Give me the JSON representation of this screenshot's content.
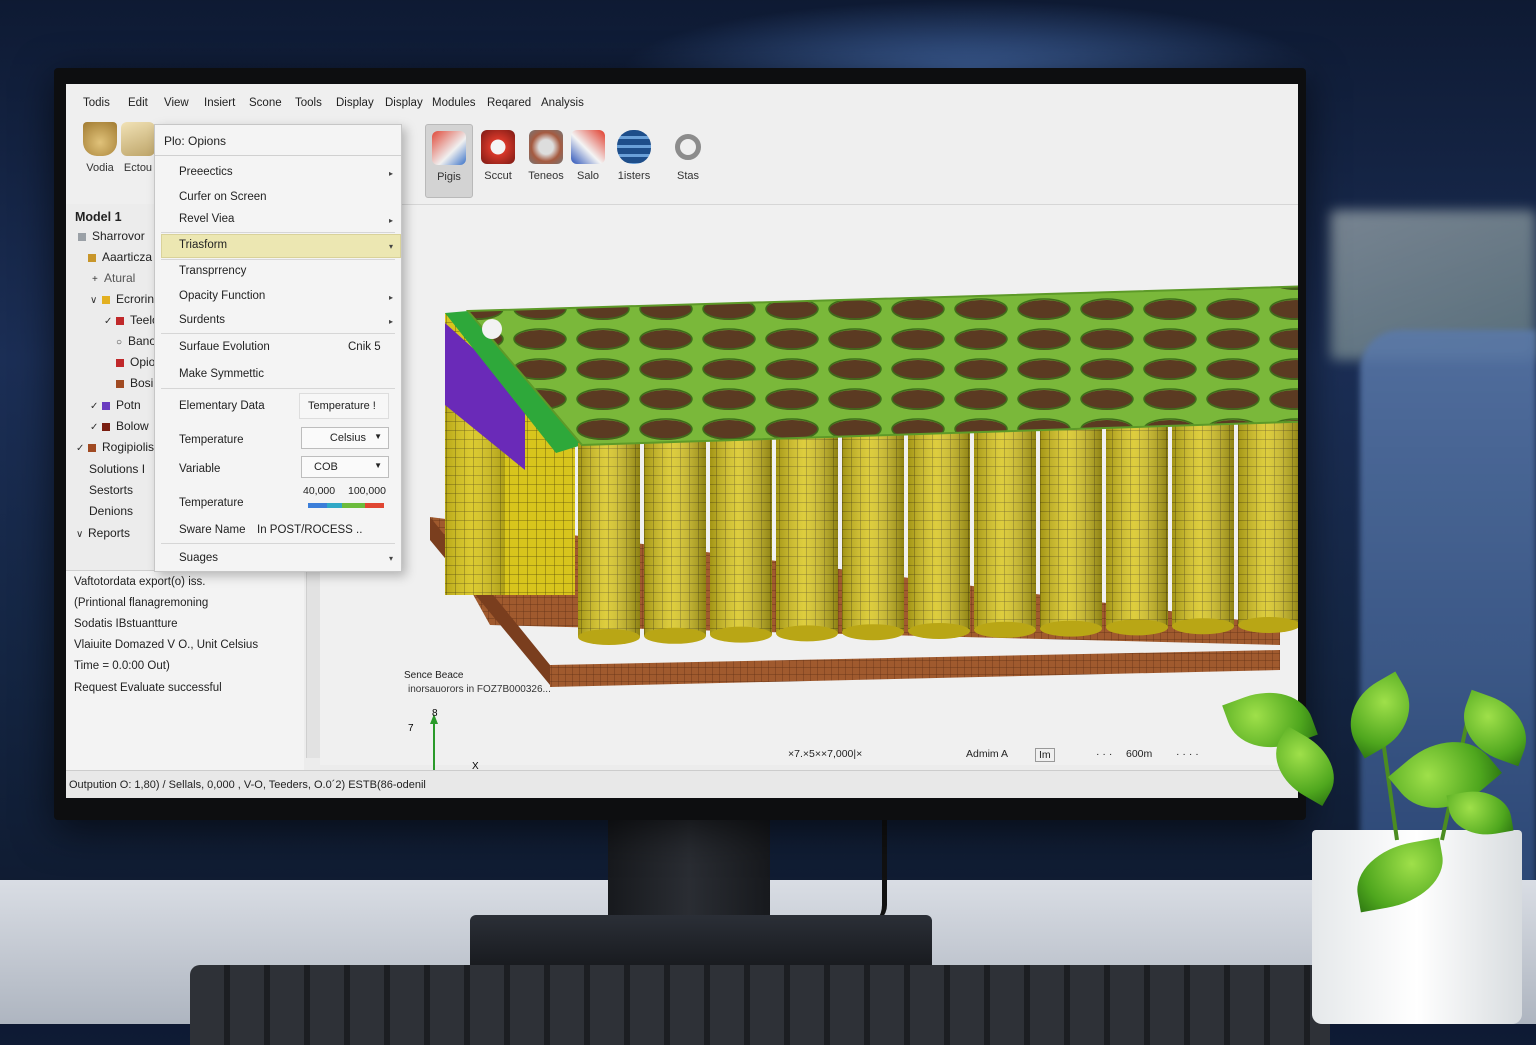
{
  "menubar": [
    "Todis",
    "Edit",
    "View",
    "Insiert",
    "Scone",
    "Tools",
    "Display",
    "Display",
    "Modules",
    "Reqared",
    "Analysis"
  ],
  "toolbar": {
    "left": [
      {
        "label": "Vodia",
        "icon": "bucket-icon"
      },
      {
        "label": "Ectou",
        "icon": "tool-icon"
      }
    ],
    "right": [
      {
        "label": "Pigis",
        "icon": "plot-icon"
      },
      {
        "label": "Sccut",
        "icon": "cut-icon"
      },
      {
        "label": "Teneos",
        "icon": "tensor-icon"
      },
      {
        "label": "Salo",
        "icon": "solo-icon"
      },
      {
        "label": "1isters",
        "icon": "layers-icon"
      },
      {
        "label": "Stas",
        "icon": "stats-icon"
      }
    ]
  },
  "tree": {
    "title": "Model 1",
    "items": [
      {
        "label": "Sharrovor",
        "color": "#9aa0a6"
      },
      {
        "label": "Aaarticza",
        "color": "#c8962a"
      },
      {
        "label": "Atural",
        "color": ""
      },
      {
        "label": "Ecrorin",
        "color": "#e3b020"
      },
      {
        "label": "Teelo",
        "color": "#c0282a"
      },
      {
        "label": "Bano",
        "color": ""
      },
      {
        "label": "Opio",
        "color": "#c0282a"
      },
      {
        "label": "Bosi",
        "color": "#a04a22"
      },
      {
        "label": "Potn",
        "color": "#6a3cc0"
      },
      {
        "label": "Bolow",
        "color": "#7a1e10"
      },
      {
        "label": "Rogipiolis",
        "color": "#a04a22"
      },
      {
        "label": "Solutions I",
        "color": ""
      },
      {
        "label": "Sestorts",
        "color": ""
      },
      {
        "label": "Denions",
        "color": ""
      },
      {
        "label": "Reports",
        "color": ""
      }
    ]
  },
  "menu": {
    "title": "Plo: Opions",
    "items": {
      "prefects": "Preeectics",
      "curfer": "Curfer on Screen",
      "revel": "Revel Viea",
      "transform": "Triasform",
      "transparency": "Transprrency",
      "opacity": "Opacity Function",
      "surdents": "Surdents",
      "surface_evolution": "Surfaue Evolution",
      "surface_shortcut": "Cnik 5",
      "make_symmetric": "Make Symmettic",
      "elementary_data": "Elementary Data",
      "elementary_value": "Temperature !",
      "temperature": "Temperature",
      "temperature_unit": "Celsius",
      "variable": "Variable",
      "variable_value": "COB",
      "temperature2": "Temperature",
      "range_min": "40,000",
      "range_max": "100,000",
      "sware_name": "Sware Name",
      "sware_value": "In POST/ROCESS ..",
      "suages": "Suages"
    }
  },
  "log": [
    "Vaftotordata export(o) iss.",
    "(Printional flanagremoning",
    "Sodatis IBstuantture",
    "Vlaiuite Domazed V O., Unit   Celsius",
    "Time = 0.0:00 Out)",
    "Request Evaluate successful"
  ],
  "viewport": {
    "caption_title": "Sence Beace",
    "caption_sub": "inorsauorors in FOZ7B000326...",
    "axis_y_top": "8",
    "axis_y_side": "7",
    "axis_x": "X",
    "status_coords": "×7.×5××7,000|×",
    "status_user": "Admim A",
    "status_box": "Im",
    "status_dots": "· · ·",
    "status_scale": "600m",
    "status_dots2": "· · · ·"
  },
  "statusbar": {
    "text": "Outpution O: 1,80)  / Sellals, 0,000 , V-O, Teeders, O.0´2)  ESTB(86-odenil"
  },
  "colors": {
    "cell_yellow": "#d8c51c",
    "grid_green": "#7ab83a",
    "base_copper": "#a05a2e",
    "side_purple": "#6a2ab8",
    "side_green": "#2ea83a"
  }
}
